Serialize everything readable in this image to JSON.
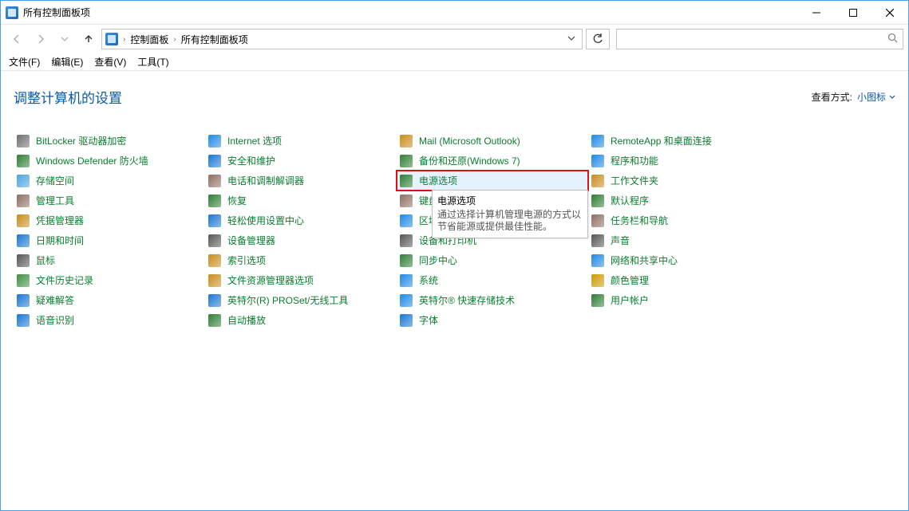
{
  "window": {
    "title": "所有控制面板项"
  },
  "breadcrumbs": {
    "root": "控制面板",
    "current": "所有控制面板项"
  },
  "search": {
    "placeholder": ""
  },
  "menu": {
    "file": "文件(F)",
    "edit": "编辑(E)",
    "view": "查看(V)",
    "tools": "工具(T)"
  },
  "heading": "调整计算机的设置",
  "viewmode": {
    "label": "查看方式:",
    "value": "小图标"
  },
  "tooltip": {
    "title": "电源选项",
    "body": "通过选择计算机管理电源的方式以节省能源或提供最佳性能。"
  },
  "items": {
    "c0": [
      "BitLocker 驱动器加密",
      "Windows Defender 防火墙",
      "存储空间",
      "管理工具",
      "凭据管理器",
      "日期和时间",
      "鼠标",
      "文件历史记录",
      "疑难解答",
      "语音识别"
    ],
    "c1": [
      "Internet 选项",
      "安全和维护",
      "电话和调制解调器",
      "恢复",
      "轻松使用设置中心",
      "设备管理器",
      "索引选项",
      "文件资源管理器选项",
      "英特尔(R) PROSet/无线工具",
      "自动播放"
    ],
    "c2": [
      "Mail (Microsoft Outlook)",
      "备份和还原(Windows 7)",
      "电源选项",
      "键盘",
      "区域",
      "设备和打印机",
      "同步中心",
      "系统",
      "英特尔® 快速存储技术",
      "字体"
    ],
    "c3": [
      "RemoteApp 和桌面连接",
      "程序和功能",
      "工作文件夹",
      "默认程序",
      "任务栏和导航",
      "声音",
      "网络和共享中心",
      "颜色管理",
      "用户帐户"
    ]
  },
  "iconColors": {
    "c0": [
      "#6e6e6e",
      "#2e7d32",
      "#4aa3df",
      "#8d6e63",
      "#c98b1a",
      "#1976d2",
      "#555555",
      "#3f8f3f",
      "#1976d2",
      "#1976d2"
    ],
    "c1": [
      "#1e88e5",
      "#1976d2",
      "#8d6e63",
      "#2e7d32",
      "#1976d2",
      "#555555",
      "#c98b1a",
      "#c98b1a",
      "#1976d2",
      "#2e7d32"
    ],
    "c2": [
      "#c98b1a",
      "#2e7d32",
      "#2e7d32",
      "#8d6e63",
      "#1e88e5",
      "#555555",
      "#2e7d32",
      "#1e88e5",
      "#1e88e5",
      "#1976d2"
    ],
    "c3": [
      "#1e88e5",
      "#1e88e5",
      "#c98b1a",
      "#2e7d32",
      "#8d6e63",
      "#555555",
      "#1e88e5",
      "#c90",
      "#2e7d32"
    ]
  }
}
